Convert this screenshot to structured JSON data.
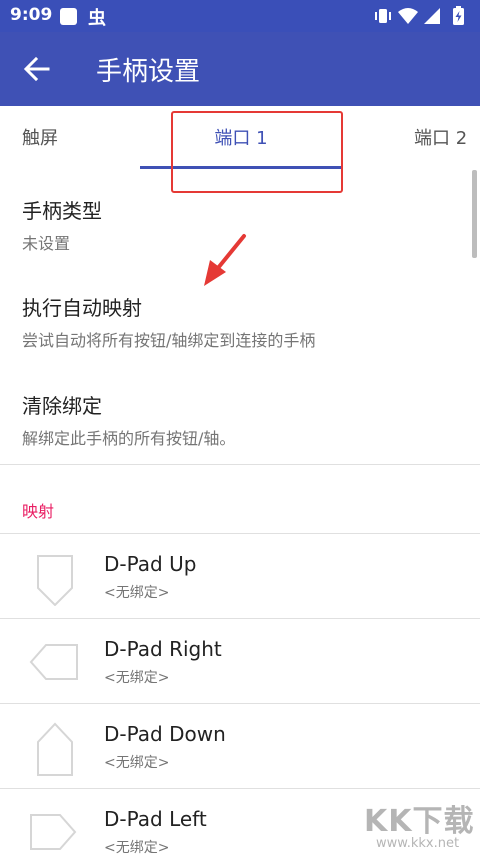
{
  "status_bar": {
    "time": "9:09",
    "notification_glyph": "虫",
    "icons": [
      "vibrate-icon",
      "wifi-icon",
      "signal-icon",
      "battery-icon"
    ]
  },
  "app_bar": {
    "title": "手柄设置",
    "back_icon": "arrow-left-icon"
  },
  "tabs": [
    {
      "label": "触屏",
      "selected": false
    },
    {
      "label": "端口 1",
      "selected": true
    },
    {
      "label": "端口 2",
      "selected": false
    }
  ],
  "settings": [
    {
      "title": "手柄类型",
      "summary": "未设置"
    },
    {
      "title": "执行自动映射",
      "summary": "尝试自动将所有按钮/轴绑定到连接的手柄"
    },
    {
      "title": "清除绑定",
      "summary": "解绑定此手柄的所有按钮/轴。"
    }
  ],
  "section_header": "映射",
  "mappings": [
    {
      "name": "D-Pad Up",
      "binding": "<无绑定>",
      "icon": "dpad-up-icon"
    },
    {
      "name": "D-Pad Right",
      "binding": "<无绑定>",
      "icon": "dpad-right-icon"
    },
    {
      "name": "D-Pad Down",
      "binding": "<无绑定>",
      "icon": "dpad-down-icon"
    },
    {
      "name": "D-Pad Left",
      "binding": "<无绑定>",
      "icon": "dpad-left-icon"
    }
  ],
  "watermark": {
    "logo": "KK下载",
    "url": "www.kkx.net"
  },
  "colors": {
    "status_bar": "#3a4fb8",
    "app_bar": "#3f51b5",
    "accent": "#3f51b5",
    "section_header": "#e91e63",
    "annotation": "#e53935"
  }
}
